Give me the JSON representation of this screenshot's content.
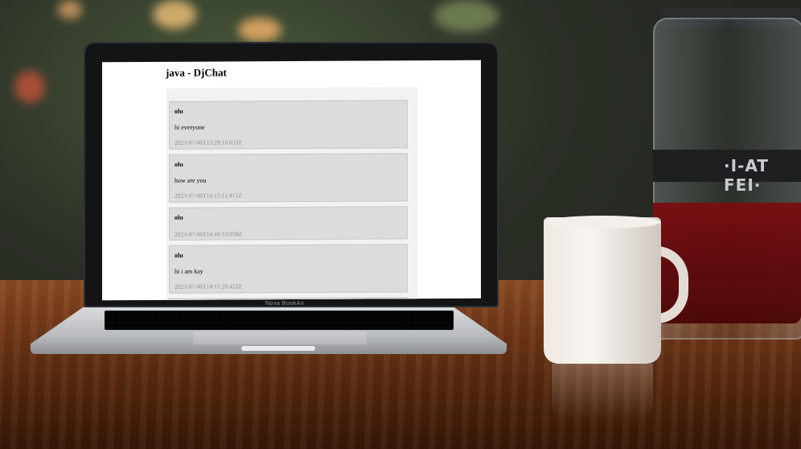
{
  "page": {
    "title": "java - DjChat"
  },
  "messages": [
    {
      "user": "olu",
      "text": "hi everyone",
      "time": "2023-07-06T13:29:10.633Z"
    },
    {
      "user": "olu",
      "text": "how are you",
      "time": "2023-07-06T14:15:11.415Z"
    },
    {
      "user": "olu",
      "text": "",
      "time": "2023-07-06T14:16:53.958Z"
    },
    {
      "user": "olu",
      "text": "hi i am kay",
      "time": "2023-07-06T14:17:20.422Z"
    }
  ],
  "laptop": {
    "brand": "Nova BookAir"
  },
  "jar": {
    "logo": "·I-AT FEI·"
  },
  "colors": {
    "page_bg": "#ffffff",
    "chat_bg": "#f2f2f2",
    "message_bg": "#dcdcdc",
    "timestamp": "#8a8a8a"
  }
}
